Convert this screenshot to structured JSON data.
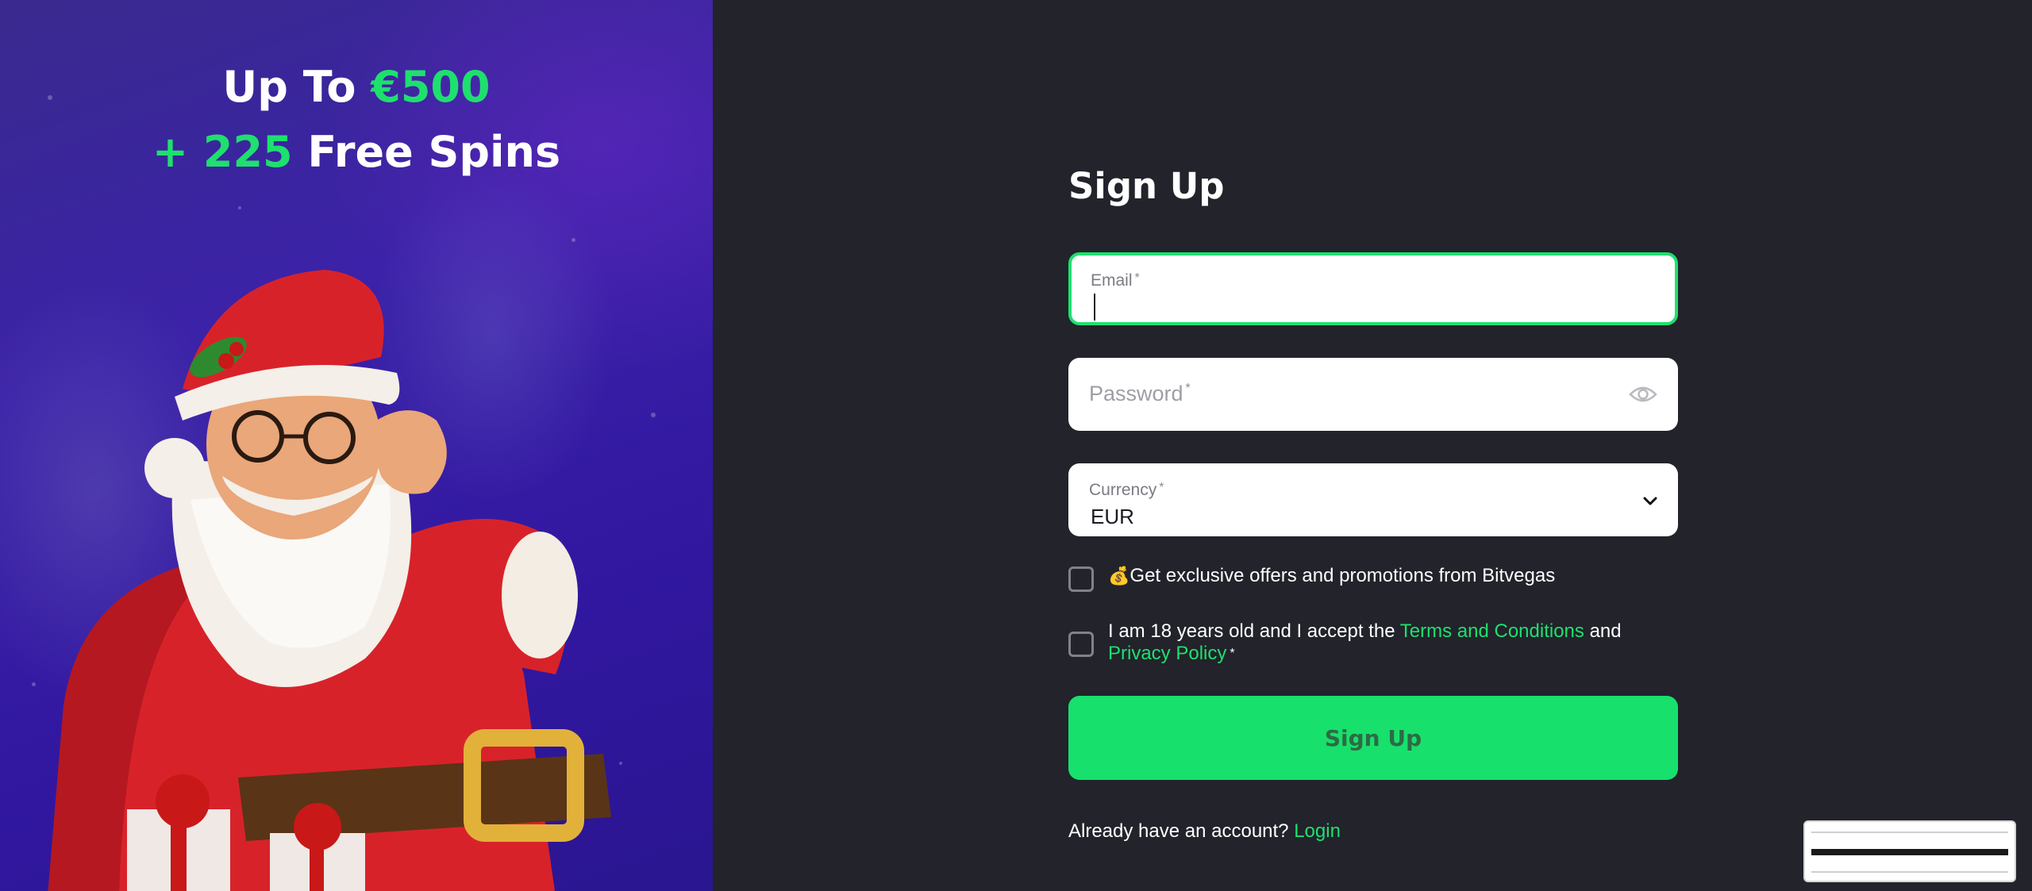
{
  "promo": {
    "line1_prefix": "Up To ",
    "line1_amount": "€500",
    "line2_prefix": "+ 225",
    "line2_suffix": " Free Spins"
  },
  "form": {
    "title": "Sign Up",
    "email": {
      "label": "Email",
      "required_mark": "*",
      "value": ""
    },
    "password": {
      "placeholder": "Password",
      "required_mark": "*",
      "toggle_icon": "eye-icon"
    },
    "currency": {
      "label": "Currency",
      "required_mark": "*",
      "selected": "EUR",
      "icon": "chevron-down-icon"
    },
    "offers": {
      "emoji": "💰",
      "text": "Get exclusive offers and promotions from Bitvegas",
      "checked": false
    },
    "terms": {
      "text_before": "I am 18 years old and I accept the ",
      "terms_link": "Terms and Conditions",
      "text_between": " and ",
      "privacy_link": "Privacy Policy",
      "required_mark": "*",
      "checked": false
    },
    "submit_label": "Sign Up",
    "footer_text": "Already have an account? ",
    "login_link": "Login"
  },
  "colors": {
    "accent": "#1ee06e",
    "background": "#22232b",
    "promo_bg": "#3b22a8"
  }
}
